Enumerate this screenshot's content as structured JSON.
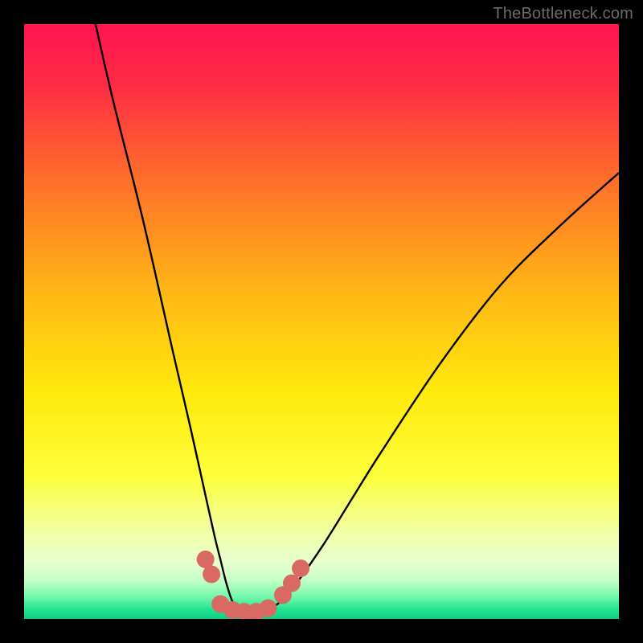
{
  "watermark": "TheBottleneck.com",
  "chart_data": {
    "type": "line",
    "title": "",
    "xlabel": "",
    "ylabel": "",
    "xlim": [
      0,
      100
    ],
    "ylim": [
      0,
      100
    ],
    "annotations": [],
    "series": [
      {
        "name": "bottleneck-curve",
        "x": [
          12,
          15,
          20,
          25,
          28,
          30,
          32,
          33,
          34,
          35,
          36,
          38,
          40,
          42,
          45,
          50,
          55,
          60,
          70,
          80,
          90,
          100
        ],
        "y": [
          100,
          87,
          67,
          45,
          32,
          23,
          14,
          10,
          6,
          3,
          2,
          1,
          1,
          2,
          5,
          12,
          20,
          28,
          43,
          56,
          66,
          75
        ]
      }
    ],
    "markers": [
      {
        "name": "dot",
        "x": 30.5,
        "y": 10.0
      },
      {
        "name": "dot",
        "x": 31.5,
        "y": 7.5
      },
      {
        "name": "dot",
        "x": 33.0,
        "y": 2.5
      },
      {
        "name": "dot",
        "x": 35.0,
        "y": 1.5
      },
      {
        "name": "dot",
        "x": 37.0,
        "y": 1.2
      },
      {
        "name": "dot",
        "x": 39.0,
        "y": 1.2
      },
      {
        "name": "dot",
        "x": 41.0,
        "y": 1.8
      },
      {
        "name": "dot",
        "x": 43.5,
        "y": 4.0
      },
      {
        "name": "dot",
        "x": 45.0,
        "y": 6.0
      },
      {
        "name": "dot",
        "x": 46.5,
        "y": 8.5
      }
    ],
    "gradient_stops": [
      {
        "offset": 0.0,
        "color": "#ff1451"
      },
      {
        "offset": 0.1,
        "color": "#ff2b45"
      },
      {
        "offset": 0.25,
        "color": "#ff6a2b"
      },
      {
        "offset": 0.45,
        "color": "#ffb716"
      },
      {
        "offset": 0.62,
        "color": "#ffe90b"
      },
      {
        "offset": 0.76,
        "color": "#fdff3b"
      },
      {
        "offset": 0.85,
        "color": "#f2ffa0"
      },
      {
        "offset": 0.905,
        "color": "#e8ffd0"
      },
      {
        "offset": 0.935,
        "color": "#c4ffc8"
      },
      {
        "offset": 0.965,
        "color": "#6cf7a8"
      },
      {
        "offset": 0.985,
        "color": "#20e28f"
      },
      {
        "offset": 1.0,
        "color": "#13cd82"
      }
    ],
    "marker_color": "#d86a63",
    "curve_color": "#000000"
  }
}
